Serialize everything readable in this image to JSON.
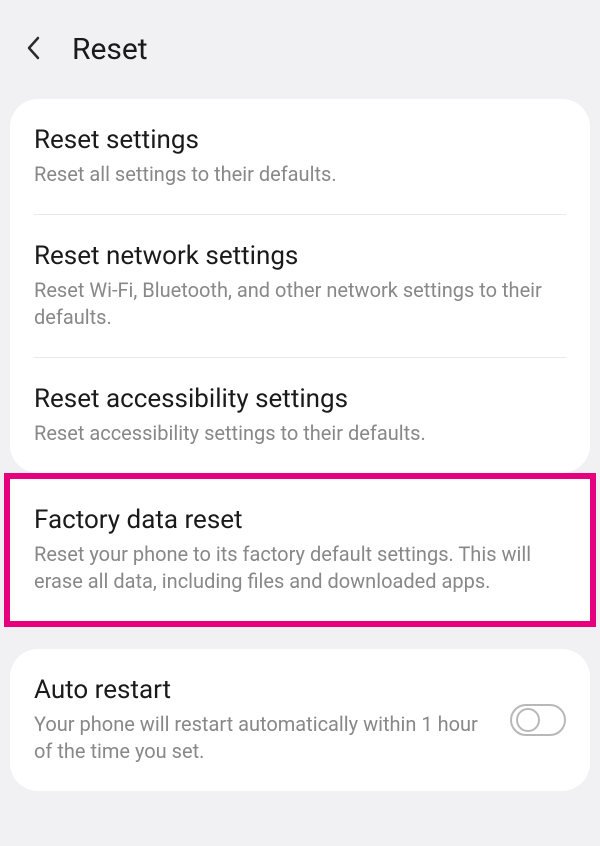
{
  "header": {
    "title": "Reset"
  },
  "items": [
    {
      "title": "Reset settings",
      "desc": "Reset all settings to their defaults."
    },
    {
      "title": "Reset network settings",
      "desc": "Reset Wi-Fi, Bluetooth, and other network settings to their defaults."
    },
    {
      "title": "Reset accessibility settings",
      "desc": "Reset accessibility settings to their defaults."
    },
    {
      "title": "Factory data reset",
      "desc": "Reset your phone to its factory default settings. This will erase all data, including files and downloaded apps."
    }
  ],
  "auto_restart": {
    "title": "Auto restart",
    "desc": "Your phone will restart automatically within 1 hour of the time you set.",
    "enabled": false
  }
}
